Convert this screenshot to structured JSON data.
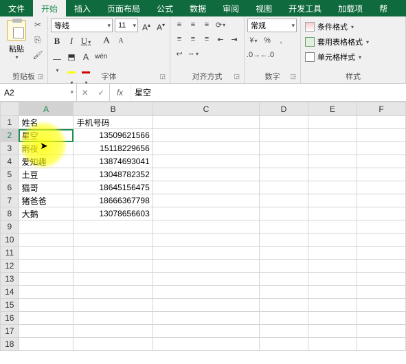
{
  "tabs": {
    "file": "文件",
    "home": "开始",
    "insert": "插入",
    "layout": "页面布局",
    "formulas": "公式",
    "data": "数据",
    "review": "审阅",
    "view": "视图",
    "developer": "开发工具",
    "addins": "加载项",
    "help": "帮"
  },
  "ribbon": {
    "clipboard": {
      "label": "剪贴板",
      "paste": "粘贴"
    },
    "font": {
      "label": "字体",
      "name": "等线",
      "size": "11",
      "ruby": "wén"
    },
    "alignment": {
      "label": "对齐方式"
    },
    "number": {
      "label": "数字",
      "format": "常规"
    },
    "styles": {
      "label": "样式",
      "cond": "条件格式",
      "table": "套用表格格式",
      "cell": "单元格样式"
    }
  },
  "nameBox": "A2",
  "formula": "星空",
  "fx": "fx",
  "columns": [
    "A",
    "B",
    "C",
    "D",
    "E",
    "F"
  ],
  "rows": [
    "1",
    "2",
    "3",
    "4",
    "5",
    "6",
    "7",
    "8",
    "9",
    "10",
    "11",
    "12",
    "13",
    "14",
    "15",
    "16",
    "17",
    "18"
  ],
  "selected": {
    "col": "A",
    "row": "2"
  },
  "chart_data": {
    "type": "table",
    "headers": {
      "A": "姓名",
      "B": "手机号码"
    },
    "records": [
      {
        "A": "星空",
        "B": "13509621566"
      },
      {
        "A": "雨夜",
        "B": "15118229656"
      },
      {
        "A": "爱知趣",
        "B": "13874693041"
      },
      {
        "A": "土豆",
        "B": "13048782352"
      },
      {
        "A": "猫哥",
        "B": "18645156475"
      },
      {
        "A": "猪爸爸",
        "B": "18666367798"
      },
      {
        "A": "大鹅",
        "B": "13078656603"
      }
    ]
  }
}
